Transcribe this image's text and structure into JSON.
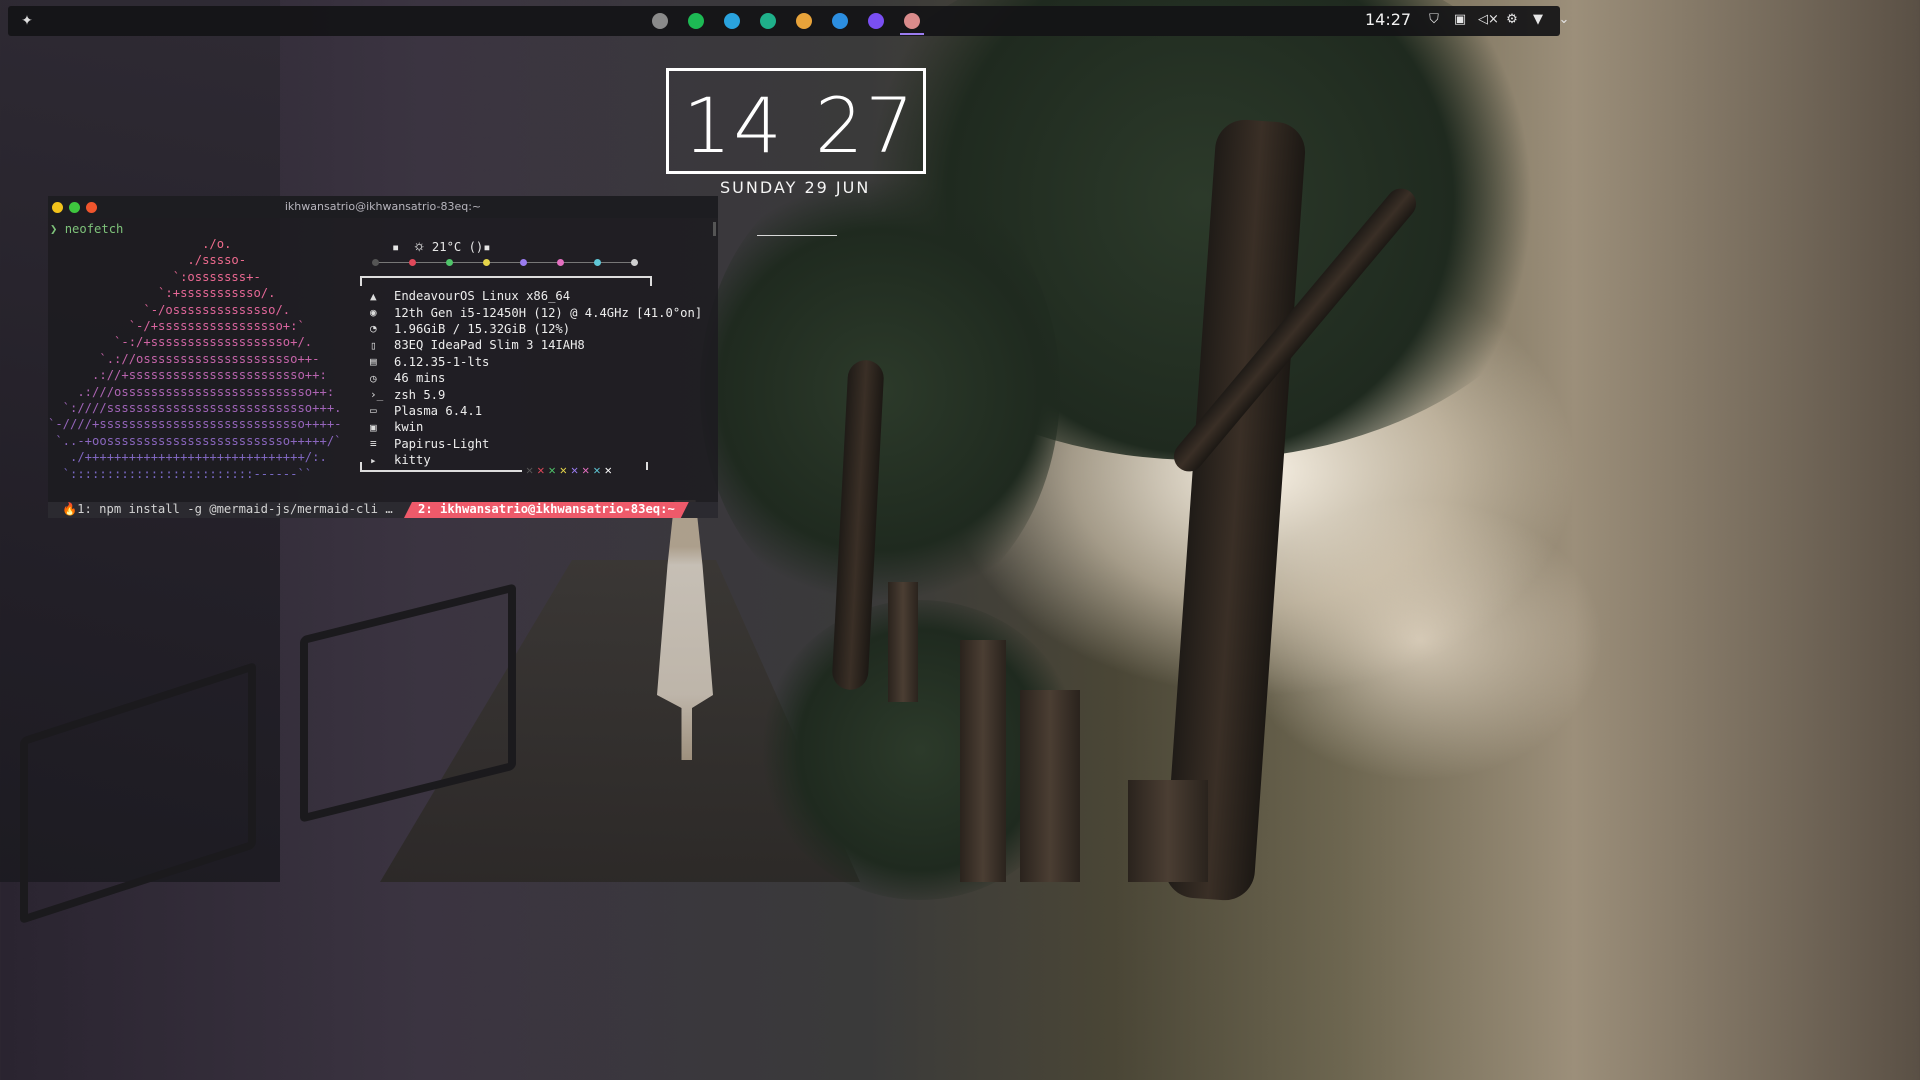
{
  "panel": {
    "time": "14:27",
    "tasks": [
      {
        "name": "chromium",
        "color": "#8a8a8a"
      },
      {
        "name": "spotify",
        "color": "#1db954"
      },
      {
        "name": "telegram",
        "color": "#2aa3de"
      },
      {
        "name": "gitkraken",
        "color": "#1fb08a"
      },
      {
        "name": "microsoft-store",
        "color": "#e8a33a"
      },
      {
        "name": "files",
        "color": "#2c8ee0"
      },
      {
        "name": "fctix",
        "color": "#7a4ff2"
      },
      {
        "name": "terminal-cat",
        "color": "#d98b8b"
      }
    ],
    "tray": [
      "shield-icon",
      "clipboard-icon",
      "volume-muted-icon",
      "settings-icon",
      "wifi-icon",
      "chevron-down-icon"
    ]
  },
  "clock": {
    "hours": "14",
    "minutes": "27",
    "date": "SUNDAY 29 JUN"
  },
  "terminal": {
    "title": "ikhwansatrio@ikhwansatrio-83eq:~",
    "prompt_symbol": "❯",
    "command": "neofetch",
    "weather": "▪  🌣 21°C ()▪",
    "logo_lines": [
      "                     ./o.",
      "                   ./sssso-",
      "                 `:osssssss+-",
      "               `:+sssssssssso/.",
      "             `-/ossssssssssssso/.",
      "           `-/+sssssssssssssssso+:`",
      "         `-:/+sssssssssssssssssso+/.",
      "       `.://osssssssssssssssssssso++-",
      "      .://+ssssssssssssssssssssssso++:",
      "    .:///ossssssssssssssssssssssssso++:",
      "  `:////ssssssssssssssssssssssssssso+++.",
      "`-////+ssssssssssssssssssssssssssso++++-",
      " `..-+oosssssssssssssssssssssssso+++++/`",
      "   ./++++++++++++++++++++++++++++++/:.",
      "  `:::::::::::::::::::::::::------``"
    ],
    "logo_colors": [
      "#f06c8c",
      "#ee6a8e",
      "#ea6892",
      "#e66796",
      "#e0669a",
      "#d9659f",
      "#d064a4",
      "#c564a9",
      "#b964ae",
      "#ad64b3",
      "#a064b8",
      "#9565bb",
      "#8a66be",
      "#8067c1",
      "#7868c3"
    ],
    "info": [
      {
        "icon": "distro-icon",
        "glyph": "▲",
        "text": "EndeavourOS Linux x86_64"
      },
      {
        "icon": "cpu-icon",
        "glyph": "◉",
        "text": "12th Gen i5-12450H (12) @ 4.4GHz [41.0°on]"
      },
      {
        "icon": "memory-icon",
        "glyph": "◔",
        "text": "1.96GiB / 15.32GiB (12%)"
      },
      {
        "icon": "host-icon",
        "glyph": "▯",
        "text": "83EQ IdeaPad Slim 3 14IAH8"
      },
      {
        "icon": "kernel-icon",
        "glyph": "▤",
        "text": "6.12.35-1-lts"
      },
      {
        "icon": "uptime-icon",
        "glyph": "◷",
        "text": "46 mins"
      },
      {
        "icon": "shell-icon",
        "glyph": "›_",
        "text": "zsh 5.9"
      },
      {
        "icon": "desktop-icon",
        "glyph": "▭",
        "text": "Plasma 6.4.1"
      },
      {
        "icon": "window-manager-icon",
        "glyph": "▣",
        "text": "kwin"
      },
      {
        "icon": "theme-icon",
        "glyph": "≡",
        "text": "Papirus-Light"
      },
      {
        "icon": "terminal-icon",
        "glyph": "▸",
        "text": "kitty"
      }
    ],
    "color_dots": [
      "#555555",
      "#e0485a",
      "#4fc46a",
      "#e5d54a",
      "#9a7cf0",
      "#e46fc0",
      "#5fc7d6",
      "#cfcfcf"
    ],
    "x_marks": [
      {
        "glyph": "✕",
        "color": "#555555"
      },
      {
        "glyph": "✕",
        "color": "#e0485a"
      },
      {
        "glyph": "✕",
        "color": "#4fc46a"
      },
      {
        "glyph": "✕",
        "color": "#e5d54a"
      },
      {
        "glyph": "✕",
        "color": "#9a7cf0"
      },
      {
        "glyph": "✕",
        "color": "#e46fc0"
      },
      {
        "glyph": "✕",
        "color": "#5fc7d6"
      },
      {
        "glyph": "✕",
        "color": "#ffffff"
      }
    ],
    "tabs": [
      {
        "label": "🔥1: npm install -g @mermaid-js/mermaid-cli …",
        "active": false
      },
      {
        "label": "2: ikhwansatrio@ikhwansatrio-83eq:~",
        "active": true
      }
    ]
  }
}
